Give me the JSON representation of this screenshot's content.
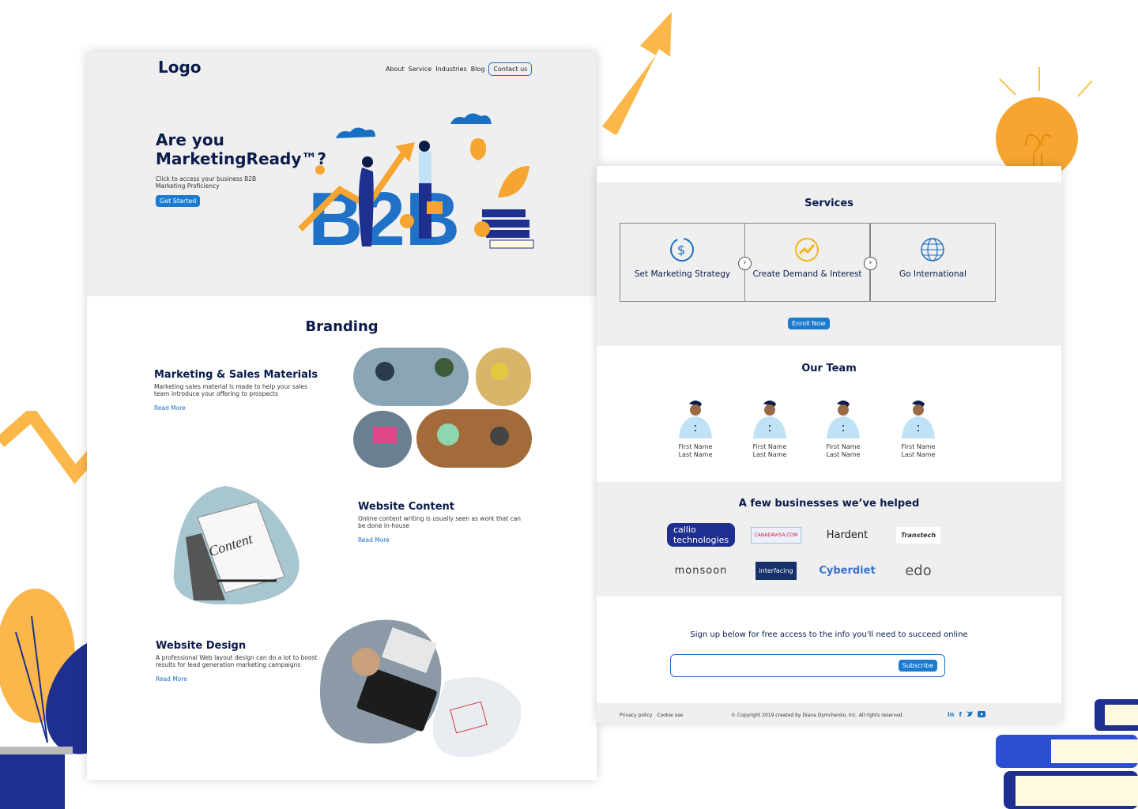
{
  "header": {
    "logo": "Logo",
    "nav": [
      "About",
      "Service",
      "Industries",
      "Blog"
    ],
    "contact": "Contact us"
  },
  "hero": {
    "title": "Are you MarketingReady™?",
    "subtitle": "Click to access your business B2B Marketing Proficiency",
    "cta": "Get Started",
    "art_text": "B2B"
  },
  "branding": {
    "title": "Branding",
    "features": [
      {
        "title": "Marketing & Sales Materials",
        "text": "Marketing sales material is made to help your sales team introduce your offering to prospects",
        "link": "Read More"
      },
      {
        "title": "Website Content",
        "text": "Online content writing is usually seen as work that can be done in-house",
        "link": "Read More"
      },
      {
        "title": "Website Design",
        "text": "A professional Web layout design can do a lot to boost results for lead generation marketing campaigns",
        "link": "Read More"
      }
    ]
  },
  "services": {
    "title": "Services",
    "items": [
      "Set Marketing Strategy",
      "Create Demand & Interest",
      "Go International"
    ],
    "cta": "Enroll Now"
  },
  "team": {
    "title": "Our Team",
    "members": [
      {
        "first": "First Name",
        "last": "Last Name"
      },
      {
        "first": "First Name",
        "last": "Last Name"
      },
      {
        "first": "First Name",
        "last": "Last Name"
      },
      {
        "first": "First Name",
        "last": "Last Name"
      }
    ]
  },
  "clients": {
    "title": "A few businesses we’ve helped",
    "logos": [
      "callio technologies",
      "CANADAVISA.COM",
      "Hardent",
      "Transtech",
      "monsoon",
      "interfacing",
      "Cyberdiet",
      "edo"
    ]
  },
  "signup": {
    "text": "Sign up below for free access to the info you'll need to succeed online",
    "button": "Subscribe"
  },
  "footer": {
    "links": [
      "Privacy policy",
      "Cookie use"
    ],
    "copyright": "© Copyright 2019 created by Diana Dymchenko, Inc. All rights reserved.",
    "social": [
      "in",
      "f",
      "t",
      "yt"
    ]
  },
  "colors": {
    "accent": "#1a7bd1",
    "navy": "#0b1b4a",
    "orange": "#f7a531",
    "band": "#efefef"
  }
}
